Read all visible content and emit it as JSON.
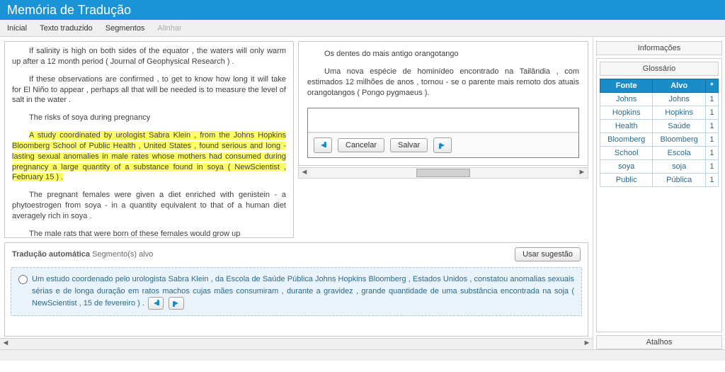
{
  "title": "Memória de Tradução",
  "menu": {
    "inicial": "Inicial",
    "texto": "Texto traduzido",
    "segmentos": "Segmentos",
    "alinhar": "Alinhar"
  },
  "source": {
    "p1": "If salinity is high on both sides of the equator , the waters will only warm up after a 12 month period ( Journal of Geophysical Research ) .",
    "p2": "If these observations are confirmed , to get to know how long it will take for El Niño to appear , perhaps all that will be needed is to measure the level of salt in the water .",
    "p3": "The risks of soya during pregnancy",
    "p4": "A study coordinated by urologist Sabra Klein , from the Johns Hopkins Bloomberg School of Public Health , United States , found serious and long - lasting sexual anomalies in male rates whose mothers had consumed during pregnancy a large quantity of a substance found in soya ( NewScientist , February 15 ) .",
    "p5": "The pregnant females were given a diet enriched with genistein - a phytoestrogen from soya - in a quantity equivalent to that of a human diet averagely rich in soya .",
    "p6": "The male rats that were born of these females would grow up"
  },
  "target": {
    "p1": "Os dentes do mais antigo orangotango",
    "p2": "Uma nova espécie de hominídeo encontrado na Tailândia , com estimados 12 milhões de anos , tornou - se o parente mais remoto dos atuais orangotangos ( Pongo pygmaeus ).",
    "cancel": "Cancelar",
    "save": "Salvar"
  },
  "mt": {
    "label_bold": "Tradução automática",
    "label_rest": "Segmento(s) alvo",
    "use_btn": "Usar sugestão",
    "suggestion": "Um estudo coordenado pelo urologista Sabra Klein , da Escola de Saúde Pública Johns Hopkins Bloomberg , Estados Unidos , constatou anomalias sexuais sérias e de longa duração em ratos machos cujas mães consumiram , durante a gravidez , grande quantidade de uma substância encontrada na soja ( NewScientist , 15 de fevereiro ) ."
  },
  "right": {
    "info": "Informações",
    "glossary": "Glossário",
    "shortcuts": "Atalhos",
    "headers": {
      "fonte": "Fonte",
      "alvo": "Alvo",
      "star": "*"
    },
    "rows": [
      {
        "f": "Johns",
        "a": "Johns",
        "n": "1"
      },
      {
        "f": "Hopkins",
        "a": "Hopkins",
        "n": "1"
      },
      {
        "f": "Health",
        "a": "Saúde",
        "n": "1"
      },
      {
        "f": "Bloomberg",
        "a": "Bloomberg",
        "n": "1"
      },
      {
        "f": "School",
        "a": "Escola",
        "n": "1"
      },
      {
        "f": "soya",
        "a": "soja",
        "n": "1"
      },
      {
        "f": "Public",
        "a": "Pública",
        "n": "1"
      }
    ]
  }
}
